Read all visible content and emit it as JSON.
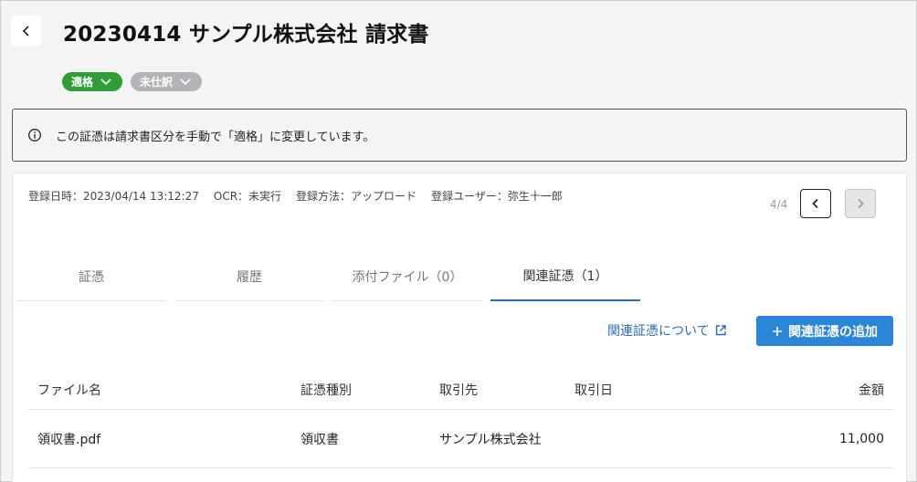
{
  "header": {
    "title": "20230414 サンプル株式会社 請求書",
    "badges": {
      "status": "適格",
      "journal": "未仕訳"
    }
  },
  "notice": {
    "text": "この証憑は請求書区分を手動で「適格」に変更しています。"
  },
  "meta": {
    "registered_at": "登録日時：2023/04/14 13:12:27",
    "ocr": "OCR：未実行",
    "method": "登録方法：アップロード",
    "user": "登録ユーザー：弥生十一郎"
  },
  "pager": {
    "text": "4/4"
  },
  "tabs": [
    {
      "label": "証憑"
    },
    {
      "label": "履歴"
    },
    {
      "label": "添付ファイル（0）"
    },
    {
      "label": "関連証憑（1）"
    }
  ],
  "actions": {
    "about_link": "関連証憑について",
    "add_button": "関連証憑の追加"
  },
  "table": {
    "headers": {
      "file": "ファイル名",
      "type": "証憑種別",
      "partner": "取引先",
      "date": "取引日",
      "amount": "金額"
    },
    "rows": [
      {
        "file": "領収書.pdf",
        "type": "領収書",
        "partner": "サンプル株式会社",
        "date": "",
        "amount": "11,000"
      }
    ]
  },
  "colors": {
    "accent": "#2b85d8",
    "link": "#2b6cb0",
    "success": "#2f9e36",
    "muted_badge": "#b2b4b8"
  }
}
